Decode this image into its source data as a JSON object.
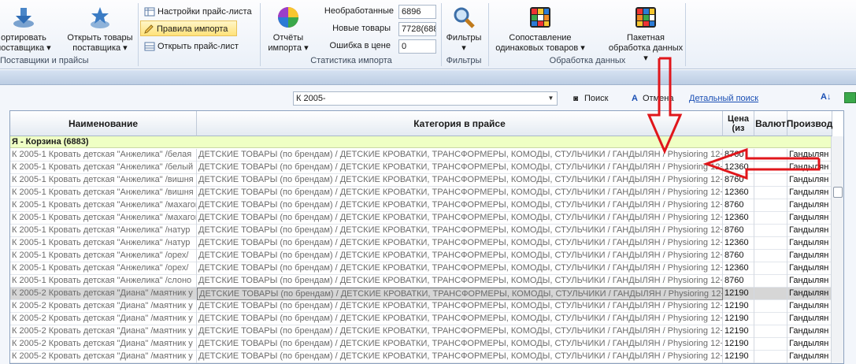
{
  "ribbon": {
    "groups": [
      {
        "label": "Поставщики и прайсы"
      },
      {
        "label": "Статистика импорта"
      },
      {
        "label": "Фильтры"
      },
      {
        "label": "Обработка данных"
      }
    ],
    "buttons": {
      "sort": {
        "line1": "ортировать",
        "line2": "поставщика ▾"
      },
      "open_goods": {
        "line1": "Открыть товары",
        "line2": "поставщика ▾"
      },
      "settings": "Настройки прайс-листа",
      "rules": "Правила импорта",
      "open_price": "Открыть прайс-лист",
      "reports": {
        "line1": "Отчёты",
        "line2": "импорта ▾"
      },
      "filters": {
        "line1": "Фильтры",
        "line2": "▾"
      },
      "match": {
        "line1": "Сопоставление",
        "line2": "одинаковых товаров ▾"
      },
      "batch": {
        "line1": "Пакетная",
        "line2": "обработка данных ▾"
      }
    },
    "stats": [
      {
        "label": "Необработанные",
        "value": "6896"
      },
      {
        "label": "Новые товары",
        "value": "7728(688"
      },
      {
        "label": "Ошибка в цене",
        "value": "0"
      }
    ]
  },
  "toolbar": {
    "combo_value": "К 2005-",
    "search_label": "Поиск",
    "cancel_label": "Отмена",
    "detailed_search_label": "Детальный поиск"
  },
  "grid": {
    "headers": {
      "name": "Наименование",
      "category": "Категория в прайсе",
      "price": "Цена (из",
      "currency": "Валют",
      "manufacturer": "Производ"
    },
    "group": "Я - Корзина (6883)",
    "rows": [
      {
        "name": "К 2005-1 Кровать детская \"Анжелика\" /белая",
        "category": "ДЕТСКИЕ ТОВАРЫ  (по брендам) / ДЕТСКИЕ КРОВАТКИ, ТРАНСФОРМЕРЫ, КОМОДЫ, СТУЛЬЧИКИ / ГАНДЫЛЯН / Physioring 12+",
        "price": "8760",
        "currency": "",
        "manufacturer": "Гандылян"
      },
      {
        "name": "К 2005-1 Кровать детская \"Анжелика\" /белый",
        "category": "ДЕТСКИЕ ТОВАРЫ  (по брендам) / ДЕТСКИЕ КРОВАТКИ, ТРАНСФОРМЕРЫ, КОМОДЫ, СТУЛЬЧИКИ / ГАНДЫЛЯН / Physioring 12+",
        "price": "12360",
        "currency": "",
        "manufacturer": "Гандылян"
      },
      {
        "name": "К 2005-1 Кровать детская \"Анжелика\" /вишня",
        "category": "ДЕТСКИЕ ТОВАРЫ  (по брендам) / ДЕТСКИЕ КРОВАТКИ, ТРАНСФОРМЕРЫ, КОМОДЫ, СТУЛЬЧИКИ / ГАНДЫЛЯН / Physioring 12+",
        "price": "8760",
        "currency": "",
        "manufacturer": "Гандылян"
      },
      {
        "name": "К 2005-1 Кровать детская \"Анжелика\" /вишня",
        "category": "ДЕТСКИЕ ТОВАРЫ  (по брендам) / ДЕТСКИЕ КРОВАТКИ, ТРАНСФОРМЕРЫ, КОМОДЫ, СТУЛЬЧИКИ / ГАНДЫЛЯН / Physioring 12+",
        "price": "12360",
        "currency": "",
        "manufacturer": "Гандылян"
      },
      {
        "name": "К 2005-1 Кровать детская \"Анжелика\" /махагон",
        "category": "ДЕТСКИЕ ТОВАРЫ  (по брендам) / ДЕТСКИЕ КРОВАТКИ, ТРАНСФОРМЕРЫ, КОМОДЫ, СТУЛЬЧИКИ / ГАНДЫЛЯН / Physioring 12+",
        "price": "8760",
        "currency": "",
        "manufacturer": "Гандылян"
      },
      {
        "name": "К 2005-1 Кровать детская \"Анжелика\" /махагон",
        "category": "ДЕТСКИЕ ТОВАРЫ  (по брендам) / ДЕТСКИЕ КРОВАТКИ, ТРАНСФОРМЕРЫ, КОМОДЫ, СТУЛЬЧИКИ / ГАНДЫЛЯН / Physioring 12+",
        "price": "12360",
        "currency": "",
        "manufacturer": "Гандылян"
      },
      {
        "name": "К 2005-1 Кровать детская \"Анжелика\" /натур",
        "category": "ДЕТСКИЕ ТОВАРЫ  (по брендам) / ДЕТСКИЕ КРОВАТКИ, ТРАНСФОРМЕРЫ, КОМОДЫ, СТУЛЬЧИКИ / ГАНДЫЛЯН / Physioring 12+",
        "price": "8760",
        "currency": "",
        "manufacturer": "Гандылян"
      },
      {
        "name": "К 2005-1 Кровать детская \"Анжелика\" /натур",
        "category": "ДЕТСКИЕ ТОВАРЫ  (по брендам) / ДЕТСКИЕ КРОВАТКИ, ТРАНСФОРМЕРЫ, КОМОДЫ, СТУЛЬЧИКИ / ГАНДЫЛЯН / Physioring 12+",
        "price": "12360",
        "currency": "",
        "manufacturer": "Гандылян"
      },
      {
        "name": "К 2005-1 Кровать детская \"Анжелика\" /орех/",
        "category": "ДЕТСКИЕ ТОВАРЫ  (по брендам) / ДЕТСКИЕ КРОВАТКИ, ТРАНСФОРМЕРЫ, КОМОДЫ, СТУЛЬЧИКИ / ГАНДЫЛЯН / Physioring 12+",
        "price": "8760",
        "currency": "",
        "manufacturer": "Гандылян"
      },
      {
        "name": "К 2005-1 Кровать детская \"Анжелика\" /орех/",
        "category": "ДЕТСКИЕ ТОВАРЫ  (по брендам) / ДЕТСКИЕ КРОВАТКИ, ТРАНСФОРМЕРЫ, КОМОДЫ, СТУЛЬЧИКИ / ГАНДЫЛЯН / Physioring 12+",
        "price": "12360",
        "currency": "",
        "manufacturer": "Гандылян"
      },
      {
        "name": "К 2005-1 Кровать детская \"Анжелика\" /слоно",
        "category": "ДЕТСКИЕ ТОВАРЫ  (по брендам) / ДЕТСКИЕ КРОВАТКИ, ТРАНСФОРМЕРЫ, КОМОДЫ, СТУЛЬЧИКИ / ГАНДЫЛЯН / Physioring 12+",
        "price": "8760",
        "currency": "",
        "manufacturer": "Гандылян"
      },
      {
        "name": "К 2005-2 Кровать детская \"Диана\" /маятник у",
        "category": "ДЕТСКИЕ ТОВАРЫ  (по брендам) / ДЕТСКИЕ КРОВАТКИ, ТРАНСФОРМЕРЫ, КОМОДЫ, СТУЛЬЧИКИ / ГАНДЫЛЯН / Physioring 12+",
        "price": "12190",
        "currency": "",
        "manufacturer": "Гандылян"
      },
      {
        "name": "К 2005-2 Кровать детская \"Диана\" /маятник у",
        "category": "ДЕТСКИЕ ТОВАРЫ  (по брендам) / ДЕТСКИЕ КРОВАТКИ, ТРАНСФОРМЕРЫ, КОМОДЫ, СТУЛЬЧИКИ / ГАНДЫЛЯН / Physioring 12+",
        "price": "12190",
        "currency": "",
        "manufacturer": "Гандылян"
      },
      {
        "name": "К 2005-2 Кровать детская \"Диана\" /маятник у",
        "category": "ДЕТСКИЕ ТОВАРЫ  (по брендам) / ДЕТСКИЕ КРОВАТКИ, ТРАНСФОРМЕРЫ, КОМОДЫ, СТУЛЬЧИКИ / ГАНДЫЛЯН / Physioring 12+",
        "price": "12190",
        "currency": "",
        "manufacturer": "Гандылян"
      },
      {
        "name": "К 2005-2 Кровать детская \"Диана\" /маятник у",
        "category": "ДЕТСКИЕ ТОВАРЫ  (по брендам) / ДЕТСКИЕ КРОВАТКИ, ТРАНСФОРМЕРЫ, КОМОДЫ, СТУЛЬЧИКИ / ГАНДЫЛЯН / Physioring 12+",
        "price": "12190",
        "currency": "",
        "manufacturer": "Гандылян"
      },
      {
        "name": "К 2005-2 Кровать детская \"Диана\" /маятник у",
        "category": "ДЕТСКИЕ ТОВАРЫ  (по брендам) / ДЕТСКИЕ КРОВАТКИ, ТРАНСФОРМЕРЫ, КОМОДЫ, СТУЛЬЧИКИ / ГАНДЫЛЯН / Physioring 12+",
        "price": "12190",
        "currency": "",
        "manufacturer": "Гандылян"
      },
      {
        "name": "К 2005-2 Кровать детская \"Диана\" /маятник у",
        "category": "ДЕТСКИЕ ТОВАРЫ  (по брендам) / ДЕТСКИЕ КРОВАТКИ, ТРАНСФОРМЕРЫ, КОМОДЫ, СТУЛЬЧИКИ / ГАНДЫЛЯН / Physioring 12+",
        "price": "12190",
        "currency": "",
        "manufacturer": "Гандылян"
      },
      {
        "name": "К 2005-2 Кровать детская \"Диана\" /маятник у",
        "category": "ДЕТСКИЕ ТОВАРЫ  (по брендам) / ДЕТСКИЕ КРОВАТКИ, ТРАНСФОРМЕРЫ, КОМОДЫ, СТУЛЬЧИКИ / ГАНДЫЛЯН / Physioring 12+",
        "price": "12190",
        "currency": "",
        "manufacturer": "Гандылян"
      }
    ],
    "selected_row": 11
  },
  "colors": {
    "annotation_arrow": "#e0161b",
    "group_row_bg": "#efffc4",
    "ribbon_highlight": "#ffe27a"
  }
}
